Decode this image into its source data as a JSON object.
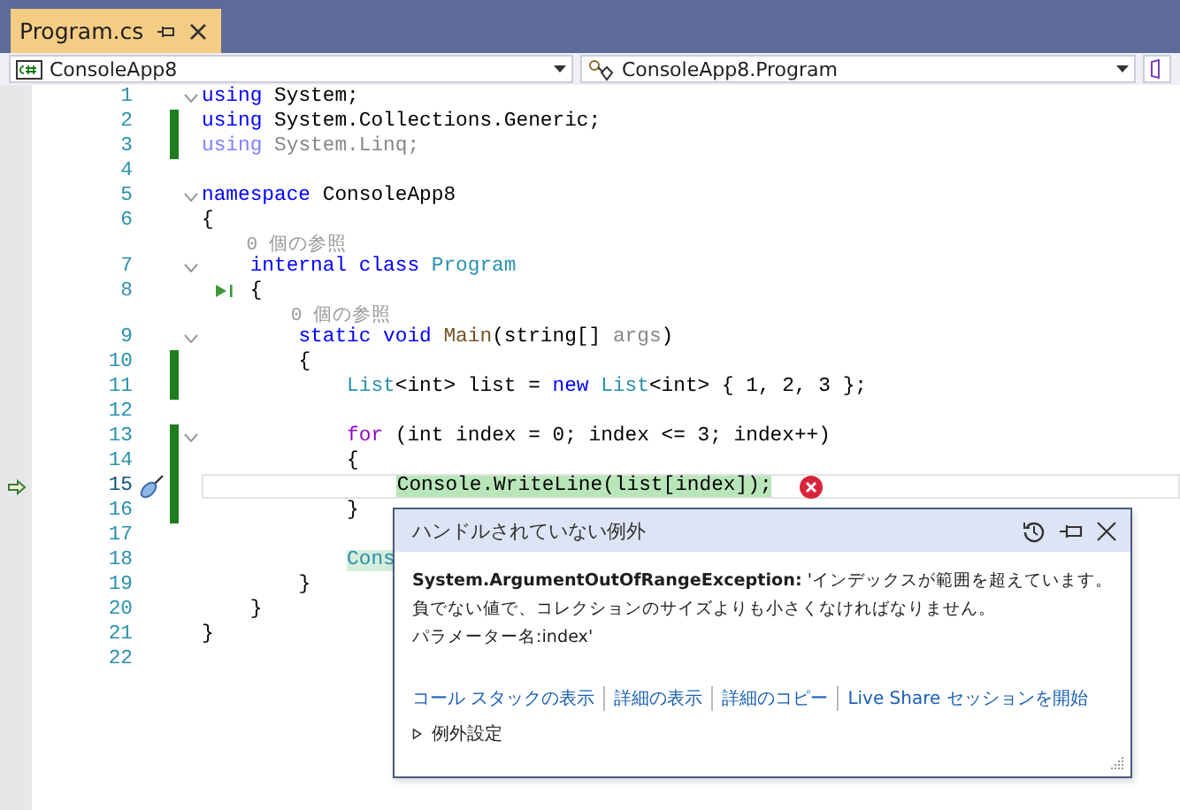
{
  "tab": {
    "title": "Program.cs",
    "selected": true
  },
  "nav": {
    "project": "ConsoleApp8",
    "member": "ConsoleApp8.Program"
  },
  "lines": [
    {
      "kind": "code",
      "number": "1",
      "changed": false,
      "fold": true,
      "current": false,
      "error": false,
      "run_marker": false,
      "edit_marker": false,
      "tokens": [
        {
          "t": "using",
          "kind": "kw"
        },
        {
          "t": " System;",
          "kind": "plain"
        }
      ]
    },
    {
      "kind": "code",
      "number": "2",
      "changed": true,
      "fold": false,
      "current": false,
      "error": false,
      "run_marker": false,
      "edit_marker": false,
      "tokens": [
        {
          "t": "using",
          "kind": "kw"
        },
        {
          "t": " System.Collections.Generic;",
          "kind": "plain"
        }
      ]
    },
    {
      "kind": "code",
      "number": "3",
      "changed": true,
      "fold": false,
      "current": false,
      "error": false,
      "run_marker": false,
      "edit_marker": false,
      "tokens": [
        {
          "t": "using",
          "kind": "kwdim"
        },
        {
          "t": " System.Linq;",
          "kind": "dim"
        }
      ]
    },
    {
      "kind": "code",
      "number": "4",
      "changed": false,
      "fold": false,
      "current": false,
      "error": false,
      "run_marker": false,
      "edit_marker": false
    },
    {
      "kind": "code",
      "number": "5",
      "changed": false,
      "fold": true,
      "current": false,
      "error": false,
      "run_marker": false,
      "edit_marker": false,
      "tokens": [
        {
          "t": "namespace",
          "kind": "kw"
        },
        {
          "t": " ConsoleApp8",
          "kind": "plain"
        }
      ]
    },
    {
      "kind": "code",
      "number": "6",
      "changed": false,
      "fold": false,
      "current": false,
      "error": false,
      "run_marker": false,
      "edit_marker": false,
      "tokens": [
        {
          "t": "{",
          "kind": "plain"
        }
      ]
    },
    {
      "kind": "lens",
      "text": "    0 個の参照"
    },
    {
      "kind": "code",
      "number": "7",
      "changed": false,
      "fold": true,
      "current": false,
      "error": false,
      "run_marker": false,
      "edit_marker": false,
      "tokens": [
        {
          "t": "    internal class",
          "kind": "kw"
        },
        {
          "t": " Program",
          "kind": "type"
        }
      ]
    },
    {
      "kind": "code",
      "number": "8",
      "changed": false,
      "fold": false,
      "current": false,
      "error": false,
      "run_marker": true,
      "edit_marker": false,
      "tokens": [
        {
          "t": "    {",
          "kind": "plain"
        }
      ]
    },
    {
      "kind": "lens",
      "text": "        0 個の参照"
    },
    {
      "kind": "code",
      "number": "9",
      "changed": false,
      "fold": true,
      "current": false,
      "error": false,
      "run_marker": false,
      "edit_marker": false,
      "tokens": [
        {
          "t": "        static void",
          "kind": "kw"
        },
        {
          "t": " Main",
          "kind": "method"
        },
        {
          "t": "(string[] ",
          "kind": "plain"
        },
        {
          "t": "args",
          "kind": "dim"
        },
        {
          "t": ")",
          "kind": "plain"
        }
      ]
    },
    {
      "kind": "code",
      "number": "10",
      "changed": true,
      "fold": false,
      "current": false,
      "error": false,
      "run_marker": false,
      "edit_marker": false,
      "tokens": [
        {
          "t": "        {",
          "kind": "plain"
        }
      ]
    },
    {
      "kind": "code",
      "number": "11",
      "changed": true,
      "fold": false,
      "current": false,
      "error": false,
      "run_marker": false,
      "edit_marker": false,
      "tokens": [
        {
          "t": "            List",
          "kind": "type"
        },
        {
          "t": "<int> list = ",
          "kind": "plain"
        },
        {
          "t": "new",
          "kind": "kw"
        },
        {
          "t": " List",
          "kind": "type"
        },
        {
          "t": "<int> { 1, 2, 3 };",
          "kind": "plain"
        }
      ]
    },
    {
      "kind": "code",
      "number": "12",
      "changed": false,
      "fold": false,
      "current": false,
      "error": false,
      "run_marker": false,
      "edit_marker": false
    },
    {
      "kind": "code",
      "number": "13",
      "changed": true,
      "fold": true,
      "current": false,
      "error": false,
      "run_marker": false,
      "edit_marker": false,
      "tokens": [
        {
          "t": "            for",
          "kind": "ctrl"
        },
        {
          "t": " (int index = 0; index <= 3; index++)",
          "kind": "plain"
        }
      ]
    },
    {
      "kind": "code",
      "number": "14",
      "changed": true,
      "fold": false,
      "current": false,
      "error": false,
      "run_marker": false,
      "edit_marker": false,
      "tokens": [
        {
          "t": "            {",
          "kind": "plain"
        }
      ]
    },
    {
      "kind": "code",
      "number": "15",
      "changed": true,
      "fold": false,
      "current": true,
      "error": true,
      "run_marker": false,
      "edit_marker": true,
      "tokens": [
        {
          "t": "                Console.WriteLine(list[index]);",
          "kind": "stmt"
        }
      ]
    },
    {
      "kind": "code",
      "number": "16",
      "changed": true,
      "fold": false,
      "current": false,
      "error": false,
      "run_marker": false,
      "edit_marker": false,
      "tokens": [
        {
          "t": "            }",
          "kind": "plain"
        }
      ]
    },
    {
      "kind": "code",
      "number": "17",
      "changed": false,
      "fold": false,
      "current": false,
      "error": false,
      "run_marker": false,
      "edit_marker": false
    },
    {
      "kind": "code",
      "number": "18",
      "changed": false,
      "fold": false,
      "current": false,
      "error": false,
      "run_marker": false,
      "edit_marker": false,
      "tokens": [
        {
          "t": "            Cons",
          "kind": "stmt2"
        }
      ]
    },
    {
      "kind": "code",
      "number": "19",
      "changed": false,
      "fold": false,
      "current": false,
      "error": false,
      "run_marker": false,
      "edit_marker": false,
      "tokens": [
        {
          "t": "        }",
          "kind": "plain"
        }
      ]
    },
    {
      "kind": "code",
      "number": "20",
      "changed": false,
      "fold": false,
      "current": false,
      "error": false,
      "run_marker": false,
      "edit_marker": false,
      "tokens": [
        {
          "t": "    }",
          "kind": "plain"
        }
      ]
    },
    {
      "kind": "code",
      "number": "21",
      "changed": false,
      "fold": false,
      "current": false,
      "error": false,
      "run_marker": false,
      "edit_marker": false,
      "tokens": [
        {
          "t": "}",
          "kind": "plain"
        }
      ]
    },
    {
      "kind": "code",
      "number": "22",
      "changed": false,
      "fold": false,
      "current": false,
      "error": false,
      "run_marker": false,
      "edit_marker": false
    }
  ],
  "exception": {
    "title": "ハンドルされていない例外",
    "message": [
      "**System.ArgumentOutOfRangeException:** 'インデックスが範囲を超えています。",
      "負でない値で、コレクションのサイズよりも小さくなければなりません。",
      "パラメーター名:index'"
    ],
    "links": [
      "コール スタックの表示",
      "詳細の表示",
      "詳細のコピー",
      "Live Share セッションを開始"
    ],
    "settings": {
      "label": "例外設定",
      "expanded": false
    }
  }
}
